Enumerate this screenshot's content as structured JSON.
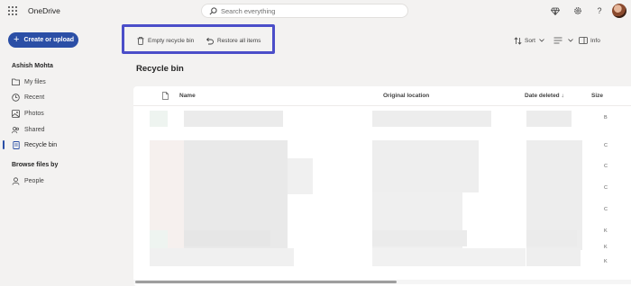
{
  "app": {
    "title": "OneDrive"
  },
  "search": {
    "placeholder": "Search everything"
  },
  "topbar": {
    "icons": [
      "diamond-icon",
      "gear-icon",
      "help-icon",
      "avatar"
    ],
    "help_glyph": "?"
  },
  "sidebar": {
    "create_label": "Create or upload",
    "user_name": "Ashish Mohta",
    "items": [
      {
        "label": "My files",
        "icon": "folder-icon"
      },
      {
        "label": "Recent",
        "icon": "clock-icon"
      },
      {
        "label": "Photos",
        "icon": "image-icon"
      },
      {
        "label": "Shared",
        "icon": "people-icon"
      },
      {
        "label": "Recycle bin",
        "icon": "trash-icon",
        "active": true
      }
    ],
    "browse_label": "Browse files by",
    "browse_items": [
      {
        "label": "People",
        "icon": "person-icon"
      }
    ]
  },
  "commandbar": {
    "empty_label": "Empty recycle bin",
    "restore_label": "Restore all items",
    "sort_label": "Sort",
    "info_label": "Info"
  },
  "page": {
    "title": "Recycle bin"
  },
  "table": {
    "columns": {
      "name": "Name",
      "original_location": "Original location",
      "date_deleted": "Date deleted",
      "date_sort_glyph": "↓",
      "size": "Size"
    },
    "size_chars": [
      "B",
      "C",
      "C",
      "C",
      "C",
      "K",
      "K",
      "K"
    ]
  },
  "colors": {
    "accent": "#2b4fa6",
    "highlight": "#4b4ec9"
  }
}
